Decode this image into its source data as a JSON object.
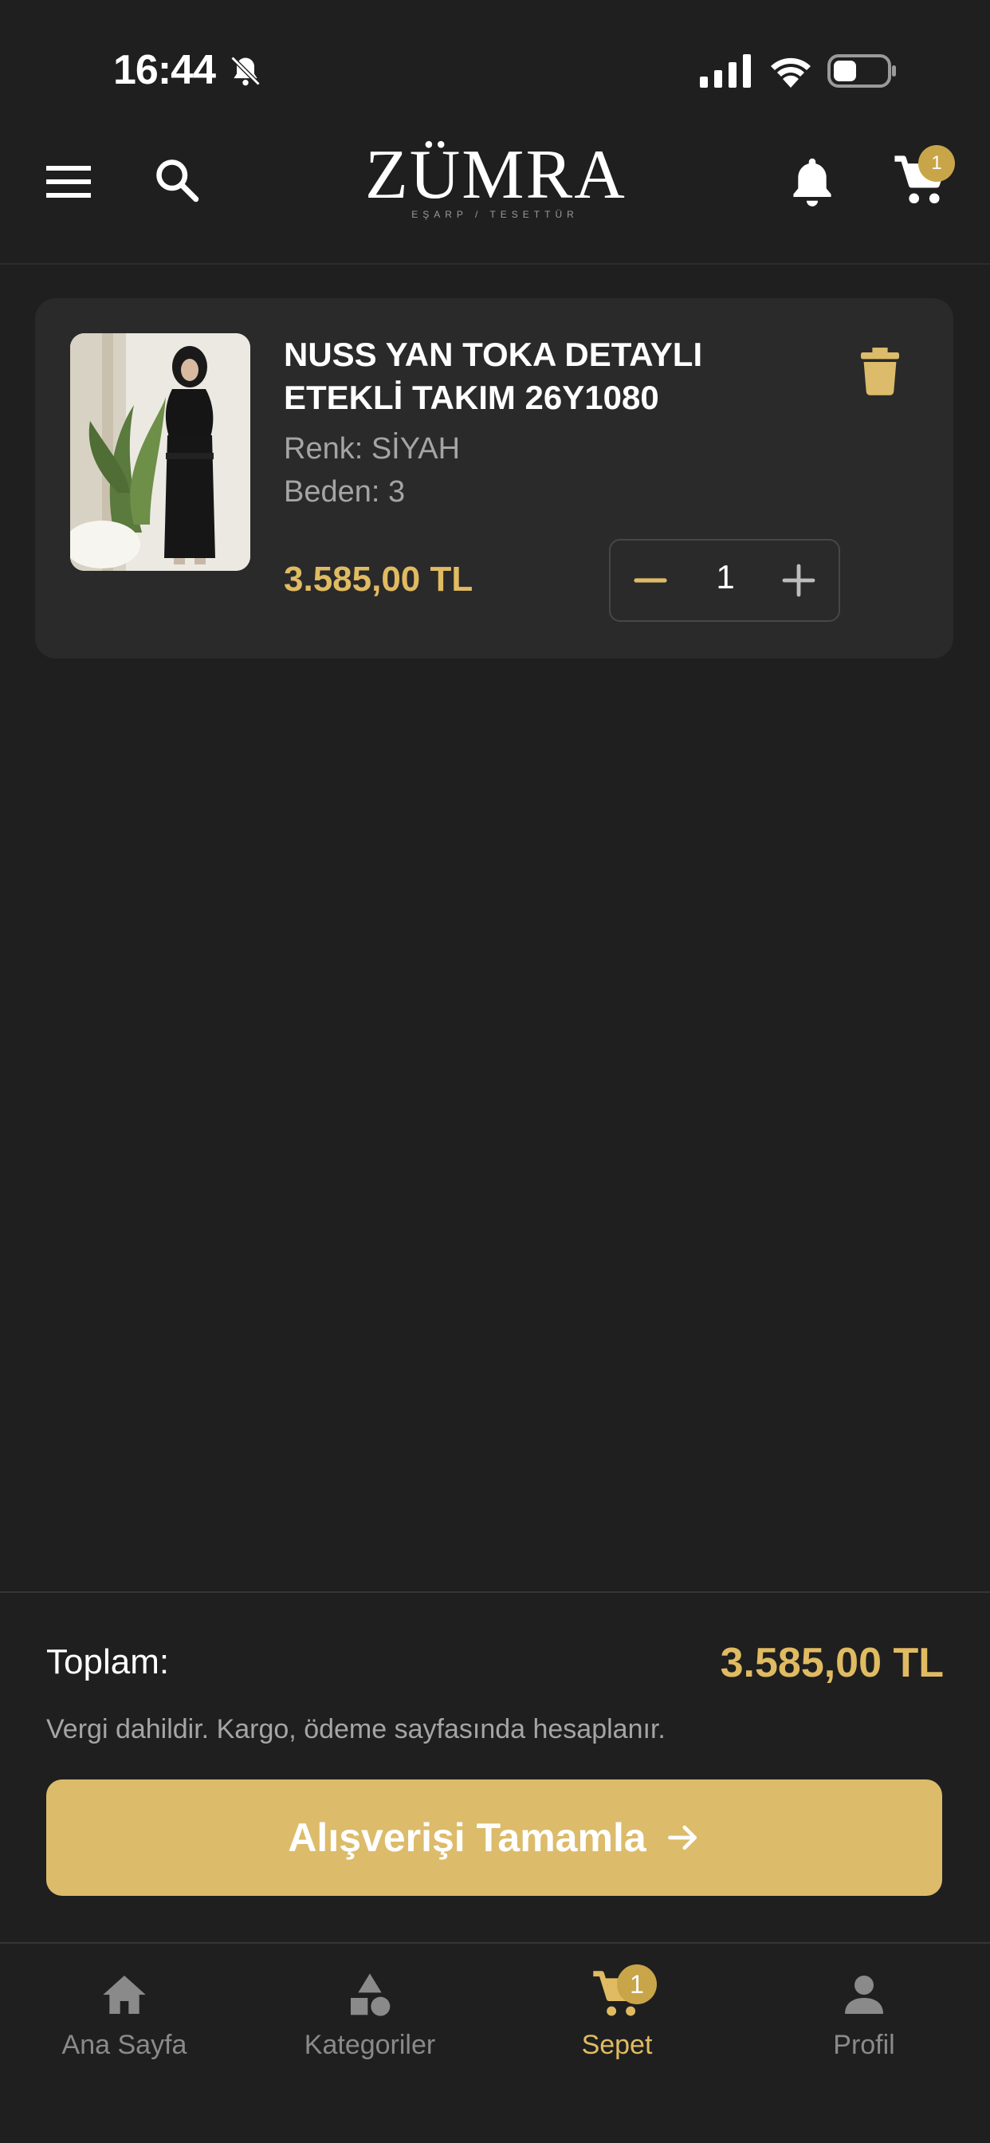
{
  "status_bar": {
    "time": "16:44"
  },
  "header": {
    "logo_word": "ZÜMRA",
    "logo_sub": "EŞARP / TESETTÜR",
    "cart_badge": "1"
  },
  "cart_item": {
    "name": "NUSS YAN TOKA DETAYLI ETEKLİ TAKIM 26Y1080",
    "color": "Renk: SİYAH",
    "size": "Beden: 3",
    "price": "3.585,00 TL",
    "quantity": "1"
  },
  "summary": {
    "total_label": "Toplam:",
    "total_value": "3.585,00 TL",
    "tax_note": "Vergi dahildir. Kargo, ödeme sayfasında hesaplanır.",
    "checkout_label": "Alışverişi Tamamla"
  },
  "tabbar": {
    "home": "Ana Sayfa",
    "categories": "Kategoriler",
    "cart": "Sepet",
    "cart_badge": "1",
    "profile": "Profil"
  },
  "colors": {
    "accent": "#e0bb62",
    "button": "#dcbb6a",
    "badge": "#c9a549",
    "background": "#1f1f1f",
    "card": "#2a2a2a"
  },
  "icons": [
    "bell-off-icon",
    "signal-icon",
    "wifi-icon",
    "battery-icon",
    "menu-icon",
    "search-icon",
    "bell-icon",
    "cart-icon",
    "trash-icon",
    "minus-icon",
    "plus-icon",
    "arrow-right-icon",
    "home-icon",
    "categories-icon",
    "profile-icon"
  ]
}
